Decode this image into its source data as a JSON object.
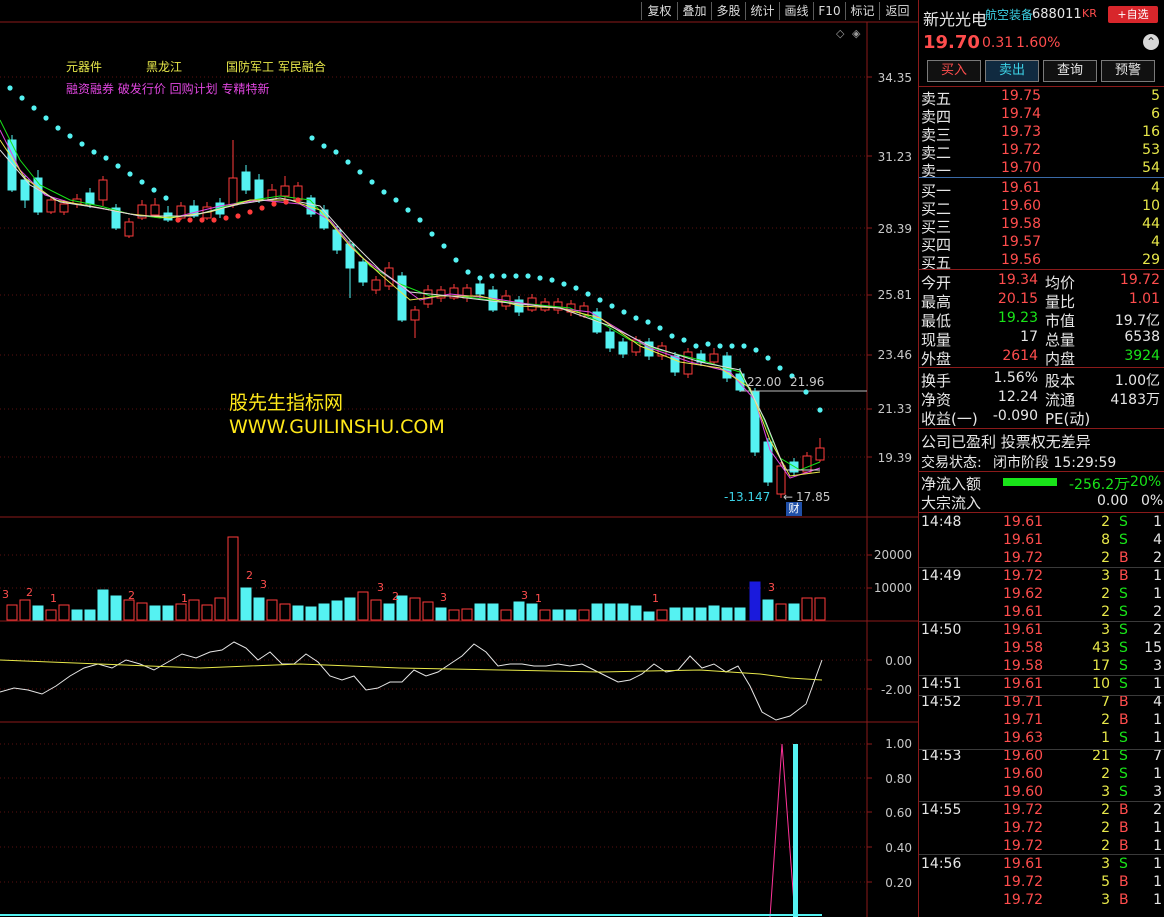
{
  "toolbar": [
    "复权",
    "叠加",
    "多股",
    "统计",
    "画线",
    "F10",
    "标记",
    "返回"
  ],
  "chart": {
    "tags1": [
      "元器件",
      "黑龙江",
      "国防军工 军民融合"
    ],
    "tags2": "融资融券 破发行价 回购计划 专精特新",
    "watermark1": "股先生指标网",
    "watermark2": "WWW.GUILINSHU.COM",
    "price_axis": [
      "34.35",
      "31.23",
      "28.39",
      "25.81",
      "23.46",
      "21.33",
      "19.39"
    ],
    "cursor_label_left": "22.00",
    "cursor_label_right": "21.96",
    "low_label_left": "-13.147",
    "low_label_right": "17.85",
    "badge": "财",
    "vol_axis": [
      "20000",
      "10000"
    ],
    "osc_axis": [
      "0.00",
      "-2.00"
    ],
    "sig_axis": [
      "1.00",
      "0.80",
      "0.60",
      "0.40",
      "0.20"
    ],
    "vol_marks": [
      "3",
      "2",
      "1",
      "2",
      "1",
      "2",
      "3",
      "3",
      "2",
      "3",
      "3",
      "1",
      "1",
      "3"
    ]
  },
  "stock": {
    "name": "新光光电",
    "sector": "航空装备",
    "code": "688011",
    "kr": "KR",
    "add_btn": "+自选",
    "price": "19.70",
    "change": "0.31",
    "pct": "1.60%"
  },
  "actions": [
    "买入",
    "卖出",
    "查询",
    "预警"
  ],
  "sells": [
    {
      "label": "卖五",
      "price": "19.75",
      "vol": "5"
    },
    {
      "label": "卖四",
      "price": "19.74",
      "vol": "6"
    },
    {
      "label": "卖三",
      "price": "19.73",
      "vol": "16"
    },
    {
      "label": "卖二",
      "price": "19.72",
      "vol": "53"
    },
    {
      "label": "卖一",
      "price": "19.70",
      "vol": "54"
    }
  ],
  "buys": [
    {
      "label": "买一",
      "price": "19.61",
      "vol": "4"
    },
    {
      "label": "买二",
      "price": "19.60",
      "vol": "10"
    },
    {
      "label": "买三",
      "price": "19.58",
      "vol": "44"
    },
    {
      "label": "买四",
      "price": "19.57",
      "vol": "4"
    },
    {
      "label": "买五",
      "price": "19.56",
      "vol": "29"
    }
  ],
  "stats": [
    {
      "l1": "今开",
      "v1": "19.34",
      "l2": "均价",
      "v2": "19.72"
    },
    {
      "l1": "最高",
      "v1": "20.15",
      "l2": "量比",
      "v2": "1.01"
    },
    {
      "l1": "最低",
      "v1": "19.23",
      "l2": "市值",
      "v2": "19.7亿"
    },
    {
      "l1": "现量",
      "v1": "17",
      "l2": "总量",
      "v2": "6538"
    },
    {
      "l1": "外盘",
      "v1": "2614",
      "l2": "内盘",
      "v2": "3924"
    }
  ],
  "stats2": [
    {
      "l1": "换手",
      "v1": "1.56%",
      "l2": "股本",
      "v2": "1.00亿"
    },
    {
      "l1": "净资",
      "v1": "12.24",
      "l2": "流通",
      "v2": "4183万"
    },
    {
      "l1": "收益(一)",
      "v1": "-0.090",
      "l2": "PE(动)",
      "v2": ""
    }
  ],
  "notice": "公司已盈利 投票权无差异",
  "trade_status_label": "交易状态:",
  "trade_status_value": "闭市阶段 15:29:59",
  "netflow_label": "净流入额",
  "netflow_value": "-256.2万",
  "netflow_pct": "-20%",
  "bigflow_label": "大宗流入",
  "bigflow_value": "0.00",
  "bigflow_pct": "0%",
  "ticks": [
    {
      "time": "14:48",
      "price": "19.61",
      "vol": "2",
      "bs": "S",
      "n": "1"
    },
    {
      "time": "",
      "price": "19.61",
      "vol": "8",
      "bs": "S",
      "n": "4"
    },
    {
      "time": "",
      "price": "19.72",
      "vol": "2",
      "bs": "B",
      "n": "2"
    },
    {
      "time": "14:49",
      "price": "19.72",
      "vol": "3",
      "bs": "B",
      "n": "1"
    },
    {
      "time": "",
      "price": "19.62",
      "vol": "2",
      "bs": "S",
      "n": "1"
    },
    {
      "time": "",
      "price": "19.61",
      "vol": "2",
      "bs": "S",
      "n": "2"
    },
    {
      "time": "14:50",
      "price": "19.61",
      "vol": "3",
      "bs": "S",
      "n": "2"
    },
    {
      "time": "",
      "price": "19.58",
      "vol": "43",
      "bs": "S",
      "n": "15"
    },
    {
      "time": "",
      "price": "19.58",
      "vol": "17",
      "bs": "S",
      "n": "3"
    },
    {
      "time": "14:51",
      "price": "19.61",
      "vol": "10",
      "bs": "S",
      "n": "1"
    },
    {
      "time": "14:52",
      "price": "19.71",
      "vol": "7",
      "bs": "B",
      "n": "4"
    },
    {
      "time": "",
      "price": "19.71",
      "vol": "2",
      "bs": "B",
      "n": "1"
    },
    {
      "time": "",
      "price": "19.63",
      "vol": "1",
      "bs": "S",
      "n": "1"
    },
    {
      "time": "14:53",
      "price": "19.60",
      "vol": "21",
      "bs": "S",
      "n": "7"
    },
    {
      "time": "",
      "price": "19.60",
      "vol": "2",
      "bs": "S",
      "n": "1"
    },
    {
      "time": "",
      "price": "19.60",
      "vol": "3",
      "bs": "S",
      "n": "3"
    },
    {
      "time": "14:55",
      "price": "19.72",
      "vol": "2",
      "bs": "B",
      "n": "2"
    },
    {
      "time": "",
      "price": "19.72",
      "vol": "2",
      "bs": "B",
      "n": "1"
    },
    {
      "time": "",
      "price": "19.72",
      "vol": "2",
      "bs": "B",
      "n": "1"
    },
    {
      "time": "14:56",
      "price": "19.61",
      "vol": "3",
      "bs": "S",
      "n": "1"
    },
    {
      "time": "",
      "price": "19.72",
      "vol": "5",
      "bs": "B",
      "n": "1"
    },
    {
      "time": "",
      "price": "19.72",
      "vol": "3",
      "bs": "B",
      "n": "1"
    }
  ]
}
